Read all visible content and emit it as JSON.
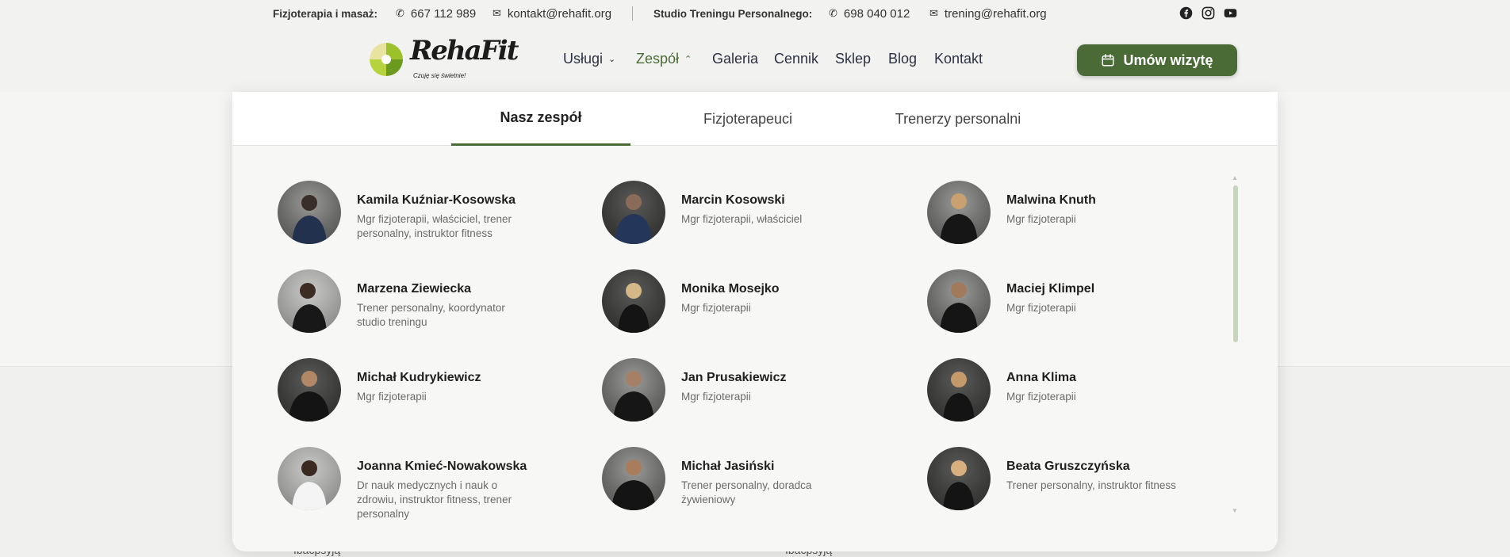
{
  "topbar": {
    "fizjo_label": "Fizjoterapia i masaż:",
    "fizjo_phone": "667 112 989",
    "fizjo_email": "kontakt@rehafit.org",
    "studio_label": "Studio Treningu Personalnego:",
    "studio_phone": "698 040 012",
    "studio_email": "trening@rehafit.org",
    "social": [
      "facebook-icon",
      "instagram-icon",
      "youtube-icon"
    ]
  },
  "logo": {
    "word": "RehaFit",
    "tagline": "Czuję się świetnie!"
  },
  "nav": {
    "items": [
      {
        "label": "Usługi",
        "has_dropdown": true
      },
      {
        "label": "Zespół",
        "has_dropdown": true,
        "active": true
      },
      {
        "label": "Galeria"
      },
      {
        "label": "Cennik"
      },
      {
        "label": "Sklep"
      },
      {
        "label": "Blog"
      },
      {
        "label": "Kontakt"
      }
    ],
    "cta": "Umów wizytę"
  },
  "mega": {
    "tabs": [
      {
        "label": "Nasz zespół",
        "active": true
      },
      {
        "label": "Fizjoterapeuci"
      },
      {
        "label": "Trenerzy personalni"
      }
    ],
    "members": [
      {
        "name": "Kamila Kuźniar-Kosowska",
        "role": "Mgr fizjoterapii, właściciel, trener personalny, instruktor fitness"
      },
      {
        "name": "Marcin Kosowski",
        "role": "Mgr fizjoterapii, właściciel"
      },
      {
        "name": "Malwina Knuth",
        "role": "Mgr fizjoterapii"
      },
      {
        "name": "Marzena Ziewiecka",
        "role": "Trener personalny, koordynator studio treningu"
      },
      {
        "name": "Monika Mosejko",
        "role": "Mgr fizjoterapii"
      },
      {
        "name": "Maciej Klimpel",
        "role": "Mgr fizjoterapii"
      },
      {
        "name": "Michał Kudrykiewicz",
        "role": "Mgr fizjoterapii"
      },
      {
        "name": "Jan Prusakiewicz",
        "role": "Mgr fizjoterapii"
      },
      {
        "name": "Anna Klima",
        "role": "Mgr fizjoterapii"
      },
      {
        "name": "Joanna Kmieć-Nowakowska",
        "role": "Dr nauk medycznych i nauk o zdrowiu, instruktor fitness, trener personalny"
      },
      {
        "name": "Michał Jasiński",
        "role": "Trener personalny, doradca żywieniowy"
      },
      {
        "name": "Beata Gruszczyńska",
        "role": "Trener personalny, instruktor fitness"
      }
    ]
  },
  "background": {
    "field_left": "Ibacpsyją",
    "field_right": "Ibacpsyją"
  },
  "colors": {
    "accent": "#4a6b35",
    "nav_active": "#4b6b36"
  }
}
